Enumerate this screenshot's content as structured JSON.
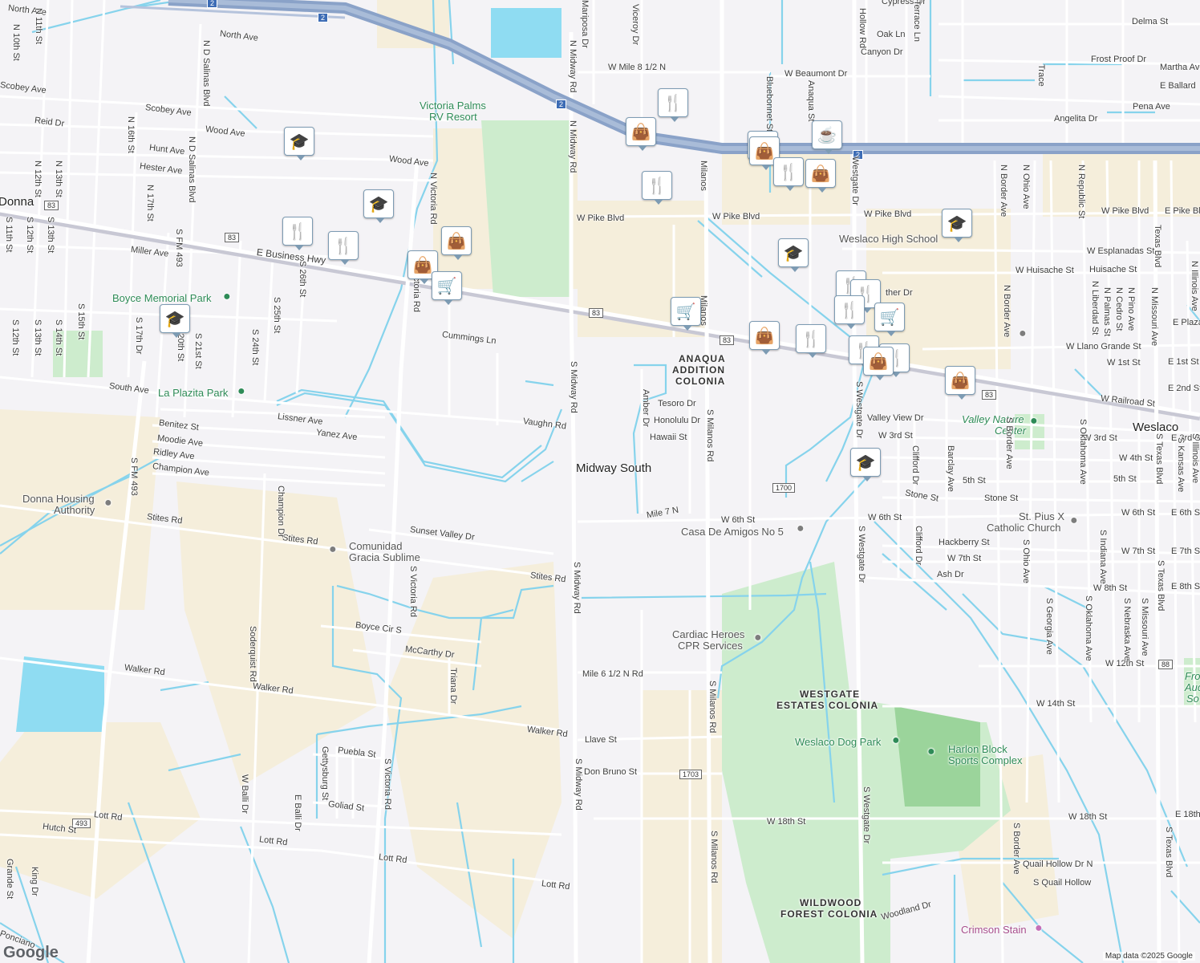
{
  "map": {
    "attribution": "Map data ©2025 Google",
    "logo": "Google",
    "places": {
      "midway_south": "Midway South",
      "weslaco": "Weslaco",
      "donna": "Donna",
      "anaqua": [
        "ANAQUA",
        "ADDITION",
        "COLONIA"
      ],
      "westgate": [
        "WESTGATE",
        "ESTATES COLONIA"
      ],
      "wildwood": [
        "WILDWOOD",
        "FOREST COLONIA"
      ]
    },
    "pois": {
      "victoria_palms": [
        "Victoria Palms",
        "RV Resort"
      ],
      "boyce_park": "Boyce Memorial Park",
      "la_plazita": "La Plazita Park",
      "donna_housing": [
        "Donna Housing",
        "Authority"
      ],
      "gracia": [
        "Comunidad",
        "Gracia Sublime"
      ],
      "weslaco_high": "Weslaco High School",
      "valley_nature": [
        "Valley Nature",
        "Center"
      ],
      "st_pius": [
        "St. Pius X",
        "Catholic Church"
      ],
      "casa": "Casa De Amigos No 5",
      "cardiac": [
        "Cardiac Heroes",
        "CPR Services"
      ],
      "dog_park": "Weslaco Dog Park",
      "harlon": [
        "Harlon Block",
        "Sports Complex"
      ],
      "crimson": "Crimson Stain",
      "fro": [
        "Fro",
        "Auc",
        "So"
      ]
    },
    "shields": [
      "2",
      "2",
      "2",
      "2",
      "83",
      "83",
      "83",
      "83",
      "83",
      "1700",
      "1703",
      "88",
      "493"
    ],
    "streets": {
      "north_ave": "North Ave",
      "north_ave2": "North Ave",
      "n10": "N 10th St",
      "n11": "N 11th St",
      "scobey1": "Scobey Ave",
      "scobey2": "Scobey Ave",
      "reid": "Reid Dr",
      "wood1": "Wood Ave",
      "wood2": "Wood Ave",
      "hunt": "Hunt Ave",
      "hester": "Hester Ave",
      "n16": "N 16th St",
      "n17": "N 17th St",
      "n12": "N 12th St",
      "n13": "N 13th St",
      "ndsalinas1": "N D Salinas Blvd",
      "ndsalinas2": "N D Salinas Blvd",
      "nvictoria": "N Victoria Rd",
      "miller": "Miller Ave",
      "ebiz": "E Business Hwy",
      "cummings": "Cummings Ln",
      "south_ave": "South Ave",
      "lissner": "Lissner Ave",
      "yanez": "Yanez Ave",
      "benitez": "Benitez St",
      "moodie": "Moodie Ave",
      "ridley": "Ridley Ave",
      "champion_ave": "Champion Ave",
      "vaughn": "Vaughn Rd",
      "stites1": "Stites Rd",
      "stites2": "Stites Rd",
      "stites3": "Stites Rd",
      "sunset": "Sunset Valley Dr",
      "boyce": "Boyce Cir S",
      "mccarthy": "McCarthy Dr",
      "walker1": "Walker Rd",
      "walker2": "Walker Rd",
      "walker3": "Walker Rd",
      "puebla": "Puebla St",
      "goliad": "Goliad St",
      "hutch": "Hutch St",
      "lott1": "Lott Rd",
      "lott2": "Lott Rd",
      "lott3": "Lott Rd",
      "lott4": "Lott Rd",
      "ponciano": "Ponciano",
      "grande": "Grande St",
      "king": "King Dr",
      "sfm493a": "S FM 493",
      "sfm493b": "S FM 493",
      "champion_dr": "Champion Dr",
      "soderquist": "Soderquist Rd",
      "svictoria1": "S Victoria Rd",
      "svictoria2": "S Victoria Rd",
      "svictoria3": "S Victoria Rd",
      "triana": "Triana Dr",
      "wballi": "W Balli Dr",
      "eballi": "E Balli Dr",
      "gettysburg": "Gettysburg St",
      "s11": "S 11th St",
      "s12": "S 12th St",
      "s13": "S 13th St",
      "s14": "S 14th St",
      "s15": "S 15th St",
      "s17": "S 17th Dr",
      "s20": "S 20th St",
      "s21": "S 21st St",
      "s24": "S 24th St",
      "s25": "S 25th St",
      "s26": "S 26th St",
      "s12b": "S 12th St",
      "s13b": "S 13th St",
      "nmidway1": "N Midway Rd",
      "nmidway2": "N Midway Rd",
      "smidway1": "S Midway Rd",
      "smidway2": "S Midway Rd",
      "smidway3": "S Midway Rd",
      "smidway4": "S Midway Rd",
      "mariposa": "Mariposa Dr",
      "viceroy": "Viceroy Dr",
      "wmile85": "W Mile 8 1/2 N",
      "wpike1": "W Pike Blvd",
      "wpike2": "W Pike Blvd",
      "wpike3": "W Pike Blvd",
      "wpike4": "W Pike Blvd",
      "epike": "E Pike Blvd",
      "milanos1": "Milanos",
      "milanos2": "Milanos",
      "smilanos1": "S Milanos Rd",
      "smilanos2": "S Milanos Rd",
      "smilanos3": "S Milanos Rd",
      "amber": "Amber Dr",
      "tesoro": "Tesoro Dr",
      "honolulu": "Honolulu Dr",
      "hawaii": "Hawaii St",
      "mile7": "Mile 7 N",
      "w6th1": "W 6th St",
      "w6th2": "W 6th St",
      "w6th3": "W 6th St",
      "e6th": "E 6th St",
      "mile65": "Mile 6 1/2 N Rd",
      "llave": "Llave St",
      "donbruno": "Don Bruno St",
      "w18a": "W 18th St",
      "w18b": "W 18th St",
      "e18": "E 18th",
      "woodland": "Woodland Dr",
      "bluebonnet": "Bluebonnet St",
      "anaqua_st": "Anaqua St",
      "hollow": "Hollow Rd",
      "westgate1": "Westgate Dr",
      "swestgate1": "S Westgate Dr",
      "swestgate2": "S Westgate Dr",
      "swestgate3": "S Westgate Dr",
      "swestgate4": "S Westgate Dr",
      "wbeaumont": "W Beaumont Dr",
      "cypress": "Cypress Dr",
      "oak": "Oak Ln",
      "canyon": "Canyon Dr",
      "terrace": "Terrace Ln",
      "delma": "Delma St",
      "frost": "Frost Proof Dr",
      "martha": "Martha Ave",
      "eballard": "E Ballard",
      "pena": "Pena Ave",
      "angelita": "Angelita Dr",
      "trace": "Trace",
      "nborder": "N Border Ave",
      "nohio": "N Ohio Ave",
      "nrepublic": "N Republic St",
      "texas1": "Texas Blvd",
      "wesplanadas": "W Esplanadas St",
      "whuisache": "W Huisache St",
      "huisache": "Huisache St",
      "nillinois": "N Illinois Ave",
      "eplaza": "E Plaza S",
      "wllano": "W Llano Grande St",
      "w1st": "W 1st St",
      "e1st": "E 1st St",
      "e2nd": "E 2nd St",
      "wrailroad": "W Railroad St",
      "valley_view": "Valley View Dr",
      "w3rd1": "W 3rd St",
      "w3rd2": "W 3rd St",
      "e3rd": "E 3rd St",
      "w4th": "W 4th St",
      "fifth1": "5th St",
      "fifth2": "5th St",
      "stone1": "Stone St",
      "stone2": "Stone St",
      "clifford1": "Clifford Dr",
      "clifford2": "Clifford Dr",
      "barclay": "Barclay Ave",
      "sborder1": "S Border Ave",
      "sborder2": "S Border Ave",
      "soklahoma1": "S Oklahoma Ave",
      "soklahoma2": "S Oklahoma Ave",
      "stexas1": "S Texas Blvd",
      "stexas2": "S Texas Blvd",
      "stexas3": "S Texas Blvd",
      "skansas": "S Kansas Ave",
      "sillinois": "S Illinois Ave",
      "hackberry": "Hackberry St",
      "w7th1": "W 7th St",
      "w7th2": "W 7th St",
      "e7th": "E 7th St",
      "ash": "Ash Dr",
      "w8th": "W 8th St",
      "e8th": "E 8th St",
      "sohio": "S Ohio Ave",
      "sindiana": "S Indiana Ave",
      "snebraska": "S Nebraska Ave",
      "smissouri": "S Missouri Ave",
      "sgeorgia": "S Georgia Ave",
      "w12th": "W 12th St",
      "w14th": "W 14th St",
      "quail_n": "Quail Hollow Dr N",
      "quail_s": "S Quail Hollow",
      "nmissouri": "N Missouri Ave",
      "npino": "N Pino Ave",
      "ncedro": "N Cedro St",
      "npalmas": "N Palmas St",
      "nliberdad": "N Liberdad St",
      "wpride": "ther Dr"
    }
  }
}
